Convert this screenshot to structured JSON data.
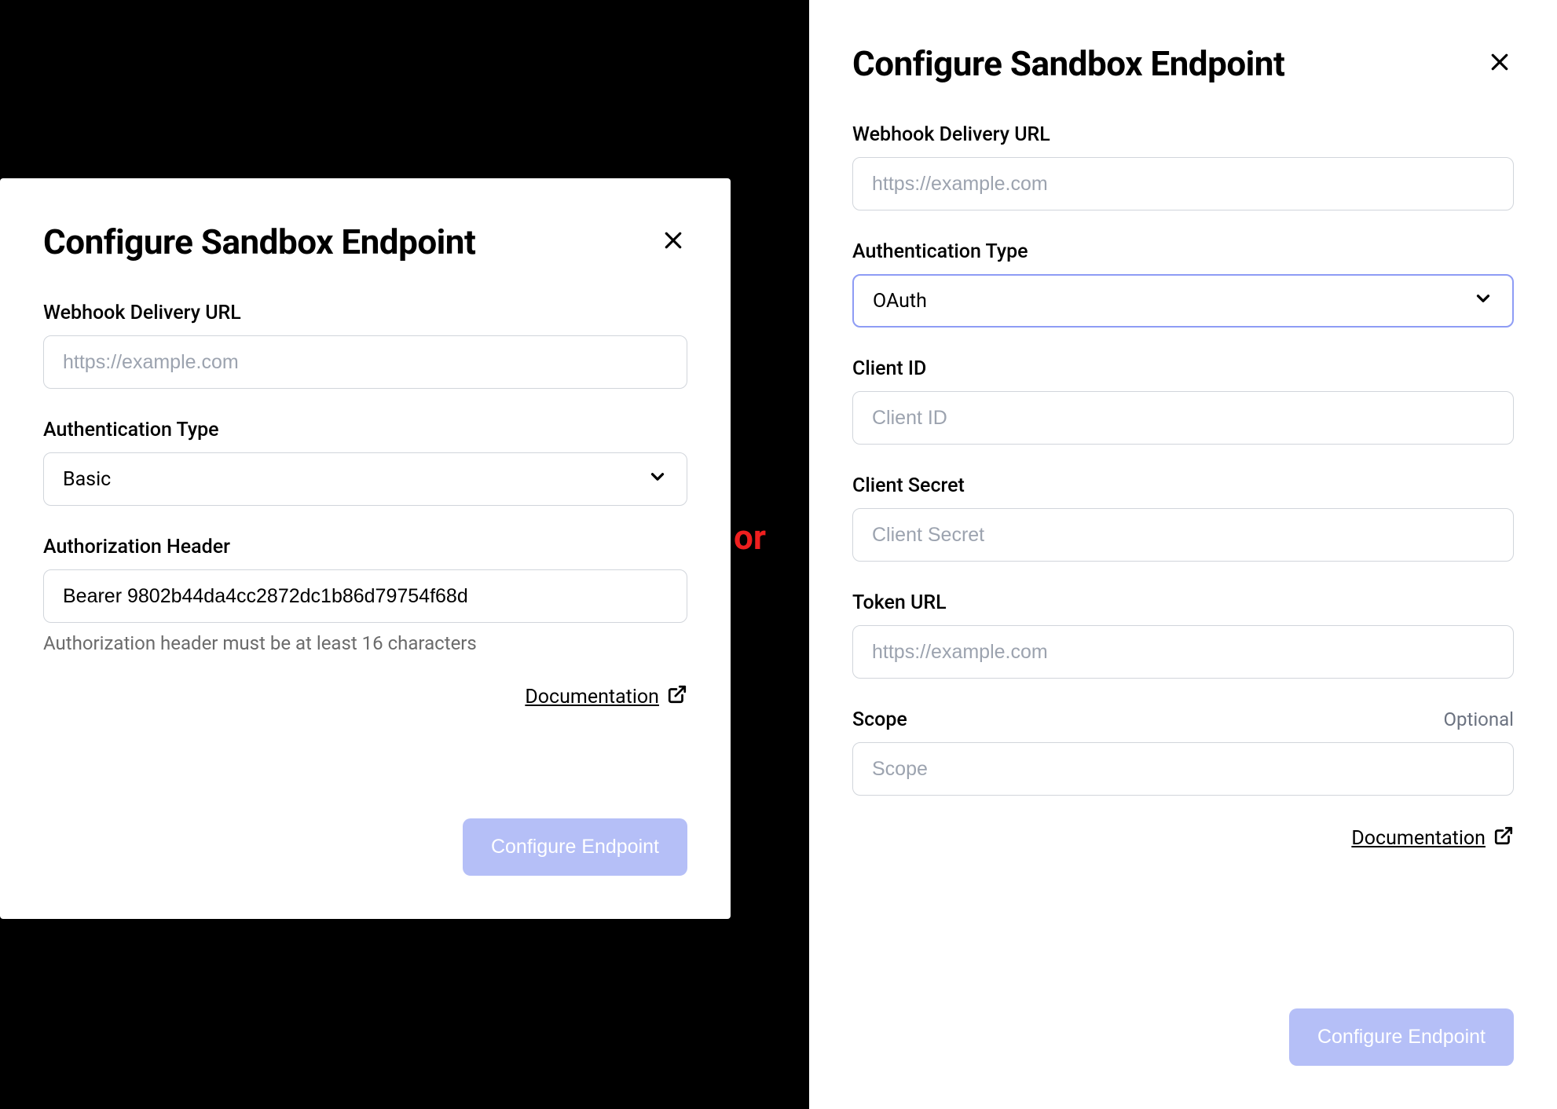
{
  "left": {
    "title": "Configure Sandbox Endpoint",
    "fields": {
      "webhook": {
        "label": "Webhook Delivery URL",
        "placeholder": "https://example.com",
        "value": ""
      },
      "authType": {
        "label": "Authentication Type",
        "value": "Basic"
      },
      "authHeader": {
        "label": "Authorization Header",
        "value": "Bearer 9802b44da4cc2872dc1b86d79754f68d",
        "helper": "Authorization header must be at least 16 characters"
      }
    },
    "documentationLabel": "Documentation",
    "submitLabel": "Configure Endpoint"
  },
  "right": {
    "title": "Configure Sandbox Endpoint",
    "fields": {
      "webhook": {
        "label": "Webhook Delivery URL",
        "placeholder": "https://example.com",
        "value": ""
      },
      "authType": {
        "label": "Authentication Type",
        "value": "OAuth"
      },
      "clientId": {
        "label": "Client ID",
        "placeholder": "Client ID",
        "value": ""
      },
      "clientSecret": {
        "label": "Client Secret",
        "placeholder": "Client Secret",
        "value": ""
      },
      "tokenUrl": {
        "label": "Token URL",
        "placeholder": "https://example.com",
        "value": ""
      },
      "scope": {
        "label": "Scope",
        "optional": "Optional",
        "placeholder": "Scope",
        "value": ""
      }
    },
    "documentationLabel": "Documentation",
    "submitLabel": "Configure Endpoint"
  },
  "separator": "or"
}
